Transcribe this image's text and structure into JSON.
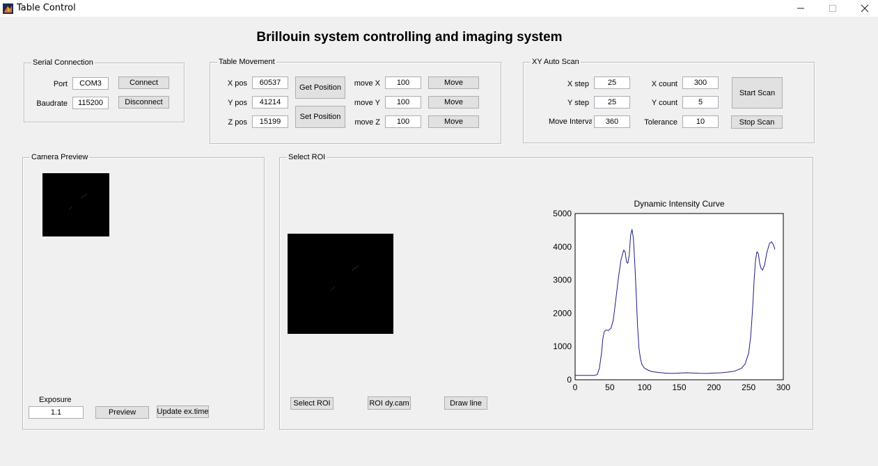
{
  "window": {
    "title": "Table Control",
    "minimize": "—",
    "maximize": "☐",
    "close": "✕"
  },
  "main_title": "Brillouin system controlling and imaging system",
  "serial": {
    "title": "Serial Connection",
    "port_label": "Port",
    "port_value": "COM3",
    "baud_label": "Baudrate",
    "baud_value": "115200",
    "connect": "Connect",
    "disconnect": "Disconnect"
  },
  "table_movement": {
    "title": "Table Movement",
    "xpos_label": "X pos",
    "xpos_value": "60537",
    "ypos_label": "Y pos",
    "ypos_value": "41214",
    "zpos_label": "Z pos",
    "zpos_value": "15199",
    "get_position": "Get Position",
    "set_position": "Set Position",
    "movex_label": "move X",
    "movex_value": "100",
    "movey_label": "move Y",
    "movey_value": "100",
    "movez_label": "move Z",
    "movez_value": "100",
    "move": "Move"
  },
  "auto_scan": {
    "title": "XY Auto Scan",
    "xstep_label": "X step",
    "xstep_value": "25",
    "ystep_label": "Y step",
    "ystep_value": "25",
    "interval_label": "Move Interva",
    "interval_value": "360",
    "xcount_label": "X count",
    "xcount_value": "300",
    "ycount_label": "Y count",
    "ycount_value": "5",
    "tolerance_label": "Tolerance",
    "tolerance_value": "10",
    "start_scan": "Start Scan",
    "stop_scan": "Stop Scan"
  },
  "camera_preview": {
    "title": "Camera Preview",
    "exposure_label": "Exposure",
    "exposure_value": "1.1",
    "preview": "Preview",
    "update_ex_time": "Update ex.time"
  },
  "select_roi": {
    "title": "Select ROI",
    "select_roi_button": "Select ROI",
    "roi_dycam_button": "ROI dy.cam",
    "draw_line_button": "Draw line"
  },
  "chart_data": {
    "type": "line",
    "title": "Dynamic Intensity Curve",
    "xlabel": "",
    "ylabel": "",
    "xlim": [
      0,
      300
    ],
    "ylim": [
      0,
      5000
    ],
    "xticks": [
      "0",
      "50",
      "100",
      "150",
      "200",
      "250",
      "300"
    ],
    "yticks": [
      "0",
      "1000",
      "2000",
      "3000",
      "4000",
      "5000"
    ],
    "grid": false,
    "line_color": "#1a1a8c",
    "series": [
      {
        "x": [
          0,
          10,
          20,
          28,
          32,
          35,
          38,
          40,
          42,
          45,
          48,
          52,
          55,
          58,
          62,
          66,
          70,
          72,
          74,
          76,
          78,
          80,
          82,
          84,
          86,
          88,
          90,
          92,
          94,
          96,
          98,
          100,
          105,
          110,
          120,
          130,
          140,
          150,
          160,
          170,
          180,
          190,
          200,
          210,
          220,
          230,
          240,
          245,
          250,
          253,
          256,
          258,
          260,
          262,
          264,
          266,
          268,
          270,
          273,
          276,
          280,
          283,
          286,
          288
        ],
        "y": [
          130,
          130,
          130,
          130,
          160,
          350,
          800,
          1250,
          1450,
          1500,
          1480,
          1560,
          1800,
          2300,
          3000,
          3600,
          3900,
          3850,
          3550,
          3500,
          3750,
          4350,
          4520,
          4250,
          3500,
          2600,
          1600,
          950,
          650,
          480,
          400,
          350,
          290,
          250,
          220,
          200,
          190,
          200,
          210,
          205,
          195,
          190,
          200,
          210,
          230,
          260,
          350,
          480,
          800,
          1300,
          2200,
          3000,
          3600,
          3850,
          3800,
          3500,
          3350,
          3300,
          3450,
          3800,
          4100,
          4150,
          4050,
          3920
        ]
      }
    ]
  }
}
